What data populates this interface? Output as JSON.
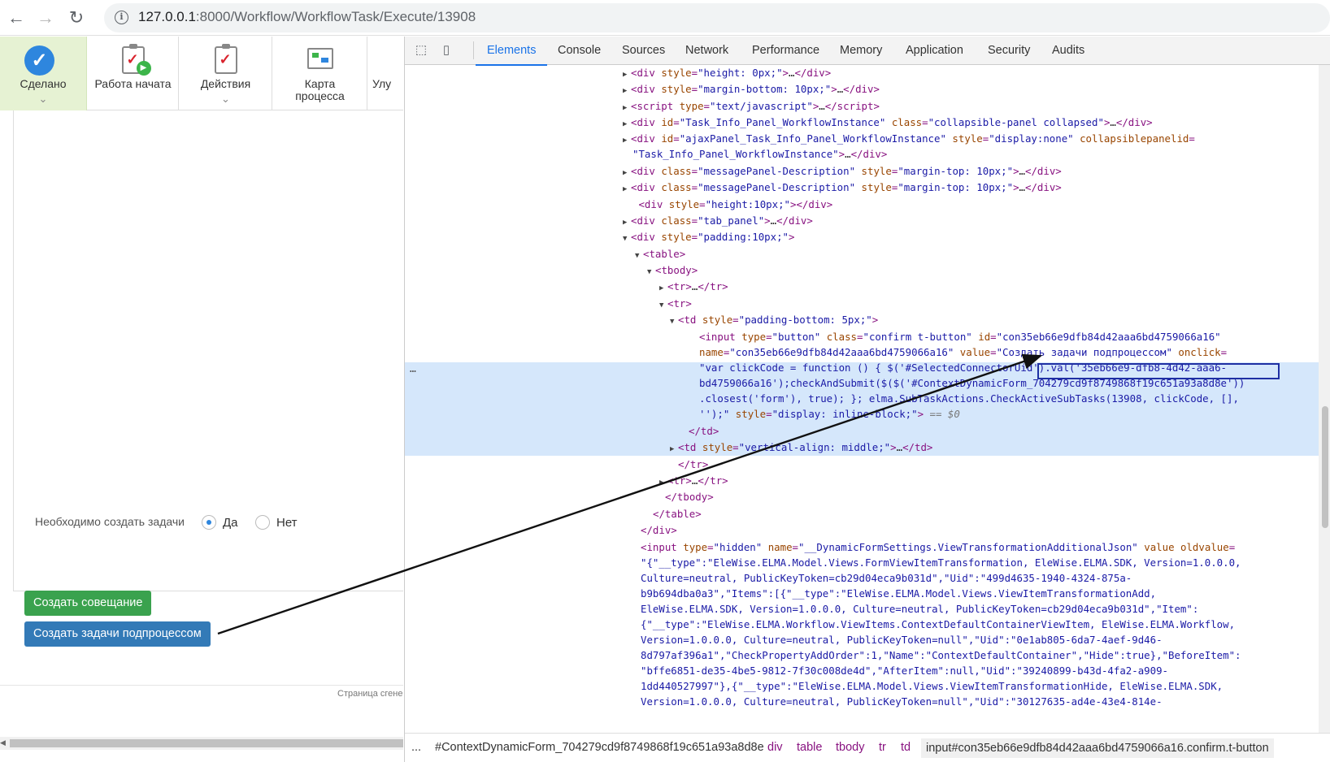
{
  "browser": {
    "url_host": "127.0.0.1",
    "url_path": ":8000/Workflow/WorkflowTask/Execute/13908",
    "back_glyph": "←",
    "forward_glyph": "→",
    "reload_glyph": "↻"
  },
  "app": {
    "toolbar": {
      "done_label": "Сделано",
      "started_label": "Работа начата",
      "actions_label": "Действия",
      "map_label_line1": "Карта",
      "map_label_line2": "процесса",
      "more_label": "Улу"
    },
    "form": {
      "question_label": "Необходимо создать задачи",
      "option_yes": "Да",
      "option_no": "Нет",
      "selected": "Да"
    },
    "buttons": {
      "create_meeting": "Создать совещание",
      "create_subtasks": "Создать задачи подпроцессом"
    },
    "footer_text": "Страница сгене"
  },
  "devtools": {
    "tabs": [
      "Elements",
      "Console",
      "Sources",
      "Network",
      "Performance",
      "Memory",
      "Application",
      "Security",
      "Audits"
    ],
    "active_tab": "Elements",
    "breadcrumbs": [
      "...",
      "#ContextDynamicForm_704279cd9f8749868f19c651a93a8d8e",
      "div",
      "table",
      "tbody",
      "tr",
      "td",
      "input#con35eb66e9dfb84d42aaa6bd4759066a16.confirm.t-button"
    ],
    "selected_hint": "== $0"
  },
  "colors": {
    "accent": "#1a73e8",
    "done_bg": "#e6f2d3",
    "green_button": "#3aa24e",
    "blue_button": "#337ab7",
    "selection": "#d5e7fb",
    "highlight_box": "#1f2fa3"
  },
  "icons": {
    "done": "checkmark-circle-icon",
    "started": "clipboard-play-icon",
    "actions": "clipboard-check-icon",
    "map": "process-map-icon",
    "inspect": "inspect-element-icon",
    "device": "device-toggle-icon"
  }
}
